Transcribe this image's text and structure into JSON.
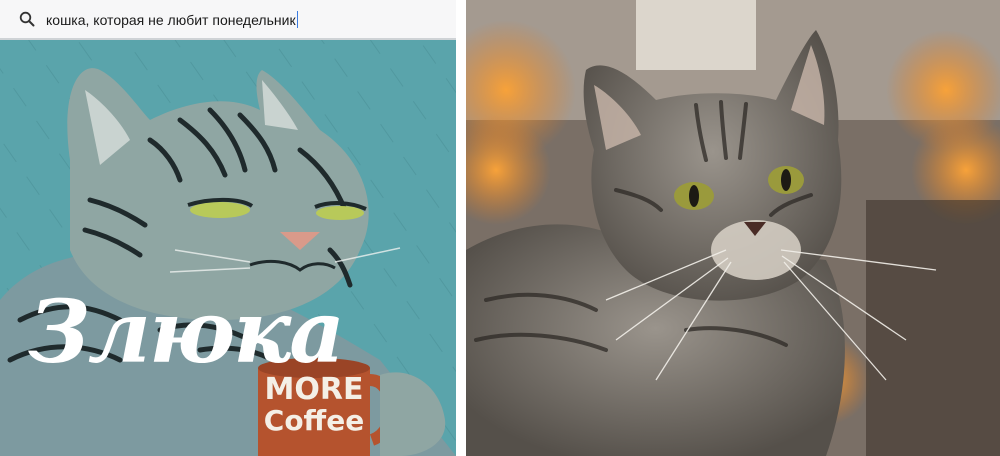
{
  "search": {
    "query": "кошка, которая не любит понедельник",
    "icon": "search-icon"
  },
  "illustration": {
    "title": "Злюка",
    "mug_text_line1": "MORE",
    "mug_text_line2": "Coffee"
  },
  "colors": {
    "illustration_background": "#5aa4ab",
    "mug": "#b5532e",
    "photo_background_orange": "#e07b1f"
  }
}
